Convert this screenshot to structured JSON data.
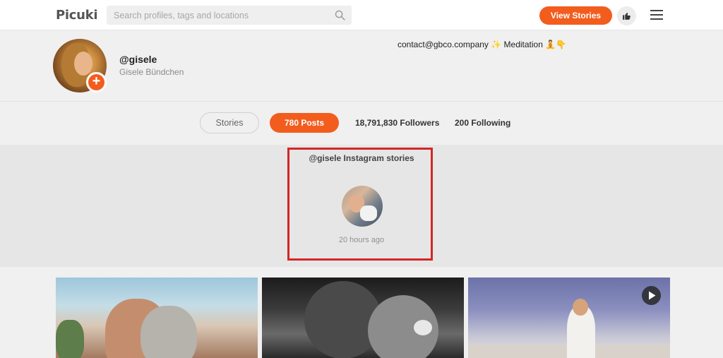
{
  "header": {
    "logo": "Picuki",
    "search_placeholder": "Search profiles, tags and locations",
    "view_stories_label": "View Stories"
  },
  "profile": {
    "username": "@gisele",
    "full_name": "Gisele Bündchen",
    "bio": "contact@gbco.company ✨ Meditation 🧘👇",
    "add_label": "+"
  },
  "stats": {
    "stories_tab": "Stories",
    "posts_tab": "780 Posts",
    "followers": "18,791,830 Followers",
    "following": "200 Following"
  },
  "stories": {
    "title": "@gisele Instagram stories",
    "items": [
      {
        "time": "20 hours ago"
      }
    ]
  },
  "colors": {
    "accent": "#f25d1e",
    "highlight_border": "#d42626"
  },
  "icons": [
    "search-icon",
    "thumbs-up-icon",
    "hamburger-menu-icon",
    "plus-icon",
    "play-icon"
  ]
}
